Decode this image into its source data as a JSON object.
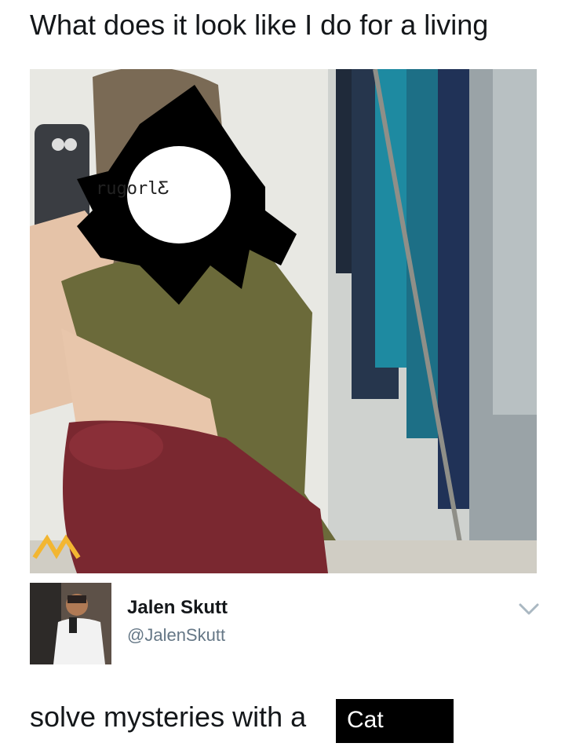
{
  "caption": "What does it look like I do for a living",
  "photo": {
    "watermark_text": "rugorlƸ"
  },
  "user": {
    "name": "Jalen Skutt",
    "handle": "@JalenSkutt",
    "menu_icon": "chevron-down-icon"
  },
  "tweet": {
    "text": "solve mysteries with a",
    "redacted_text": "Cat"
  },
  "colors": {
    "text": "#14171a",
    "handle": "#657786",
    "chevron": "#aab8c2",
    "censor": "#000000"
  }
}
